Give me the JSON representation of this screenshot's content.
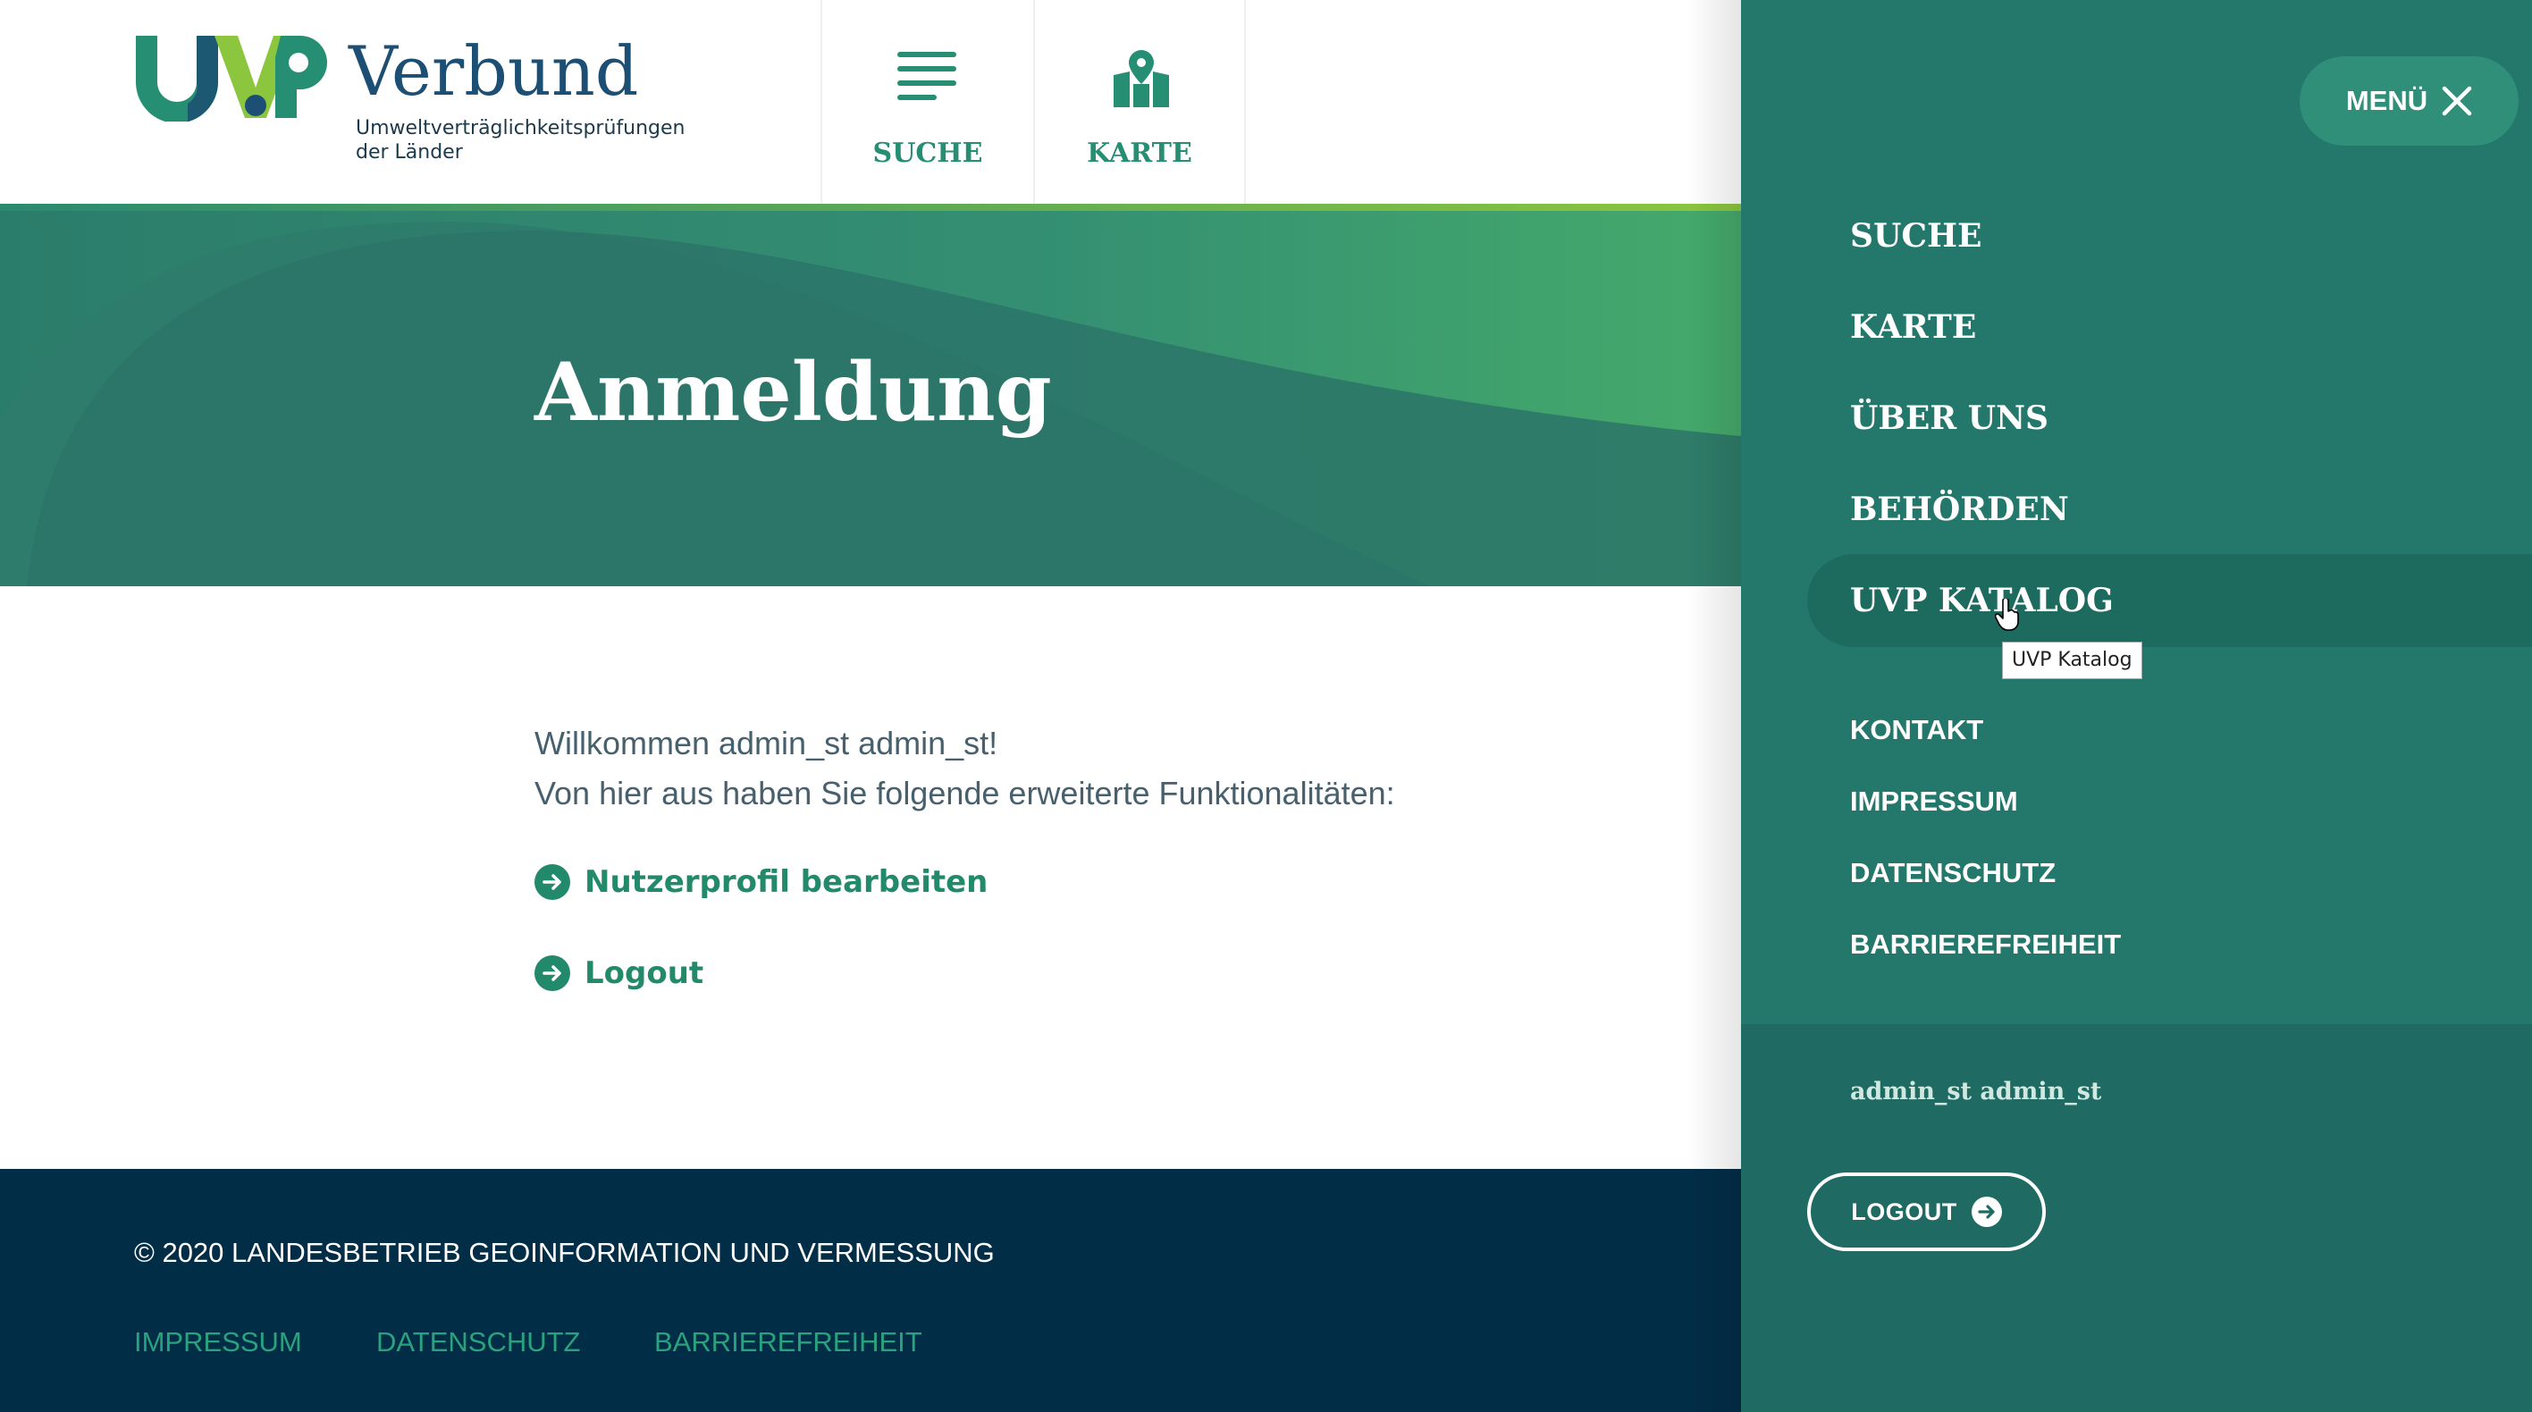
{
  "header": {
    "logo": {
      "mark_text": "UVP",
      "name": "Verbund",
      "subtitle_line1": "Umweltverträglichkeitsprüfungen",
      "subtitle_line2": "der Länder"
    },
    "nav": {
      "suche_label": "SUCHE",
      "karte_label": "KARTE"
    }
  },
  "hero": {
    "title": "Anmeldung"
  },
  "main": {
    "welcome_line1": "Willkommen admin_st admin_st!",
    "welcome_line2": "Von hier aus haben Sie folgende erweiterte Funktionalitäten:",
    "links": {
      "profile": "Nutzerprofil bearbeiten",
      "logout": "Logout"
    }
  },
  "footer": {
    "copyright": "© 2020 LANDESBETRIEB GEOINFORMATION UND VERMESSUNG",
    "links": [
      "IMPRESSUM",
      "DATENSCHUTZ",
      "BARRIEREFREIHEIT"
    ]
  },
  "menu_panel": {
    "close_label": "MENÜ",
    "main_items": [
      "SUCHE",
      "KARTE",
      "ÜBER UNS",
      "BEHÖRDEN",
      "UVP KATALOG"
    ],
    "active_item": "UVP KATALOG",
    "tooltip": "UVP Katalog",
    "sub_items": [
      "KONTAKT",
      "IMPRESSUM",
      "DATENSCHUTZ",
      "BARRIEREFREIHEIT"
    ],
    "user_name": "admin_st admin_st",
    "logout_label": "LOGOUT"
  },
  "icons": {
    "suche": "list-icon",
    "karte": "map-pin-icon",
    "close": "close-icon",
    "arrow": "arrow-right-circle-icon",
    "cursor": "hand-pointer-icon"
  },
  "colors": {
    "brand_green": "#258e73",
    "hero_teal": "#2b7968",
    "hero_light": "#42a66c",
    "panel": "#23776b",
    "panel_active": "#1d6a5e",
    "panel_bottom": "#1f6a63",
    "footer": "#022d47",
    "footer_link": "#2aa27e",
    "logo_blue": "#1c4f73",
    "logo_lime": "#8cc63e"
  }
}
